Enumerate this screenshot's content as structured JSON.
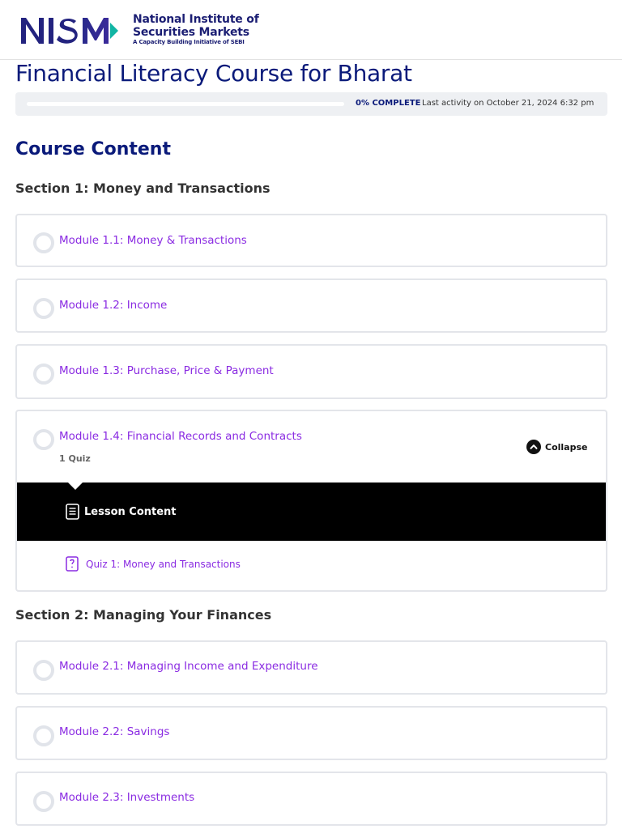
{
  "header": {
    "logo_mark": "NISM",
    "org_name_line1": "National Institute of",
    "org_name_line2": "Securities Markets",
    "tagline": "A Capacity Building Initiative of SEBI"
  },
  "course": {
    "title": "Financial Literacy Course for Bharat",
    "progress_percent": 0,
    "progress_label": "0% COMPLETE",
    "last_activity": "Last activity on October 21, 2024 6:32 pm"
  },
  "content_heading": "Course Content",
  "sections": [
    {
      "title": "Section 1: Money and Transactions",
      "modules": [
        {
          "label": "Module 1.1: Money & Transactions"
        },
        {
          "label": "Module 1.2: Income"
        },
        {
          "label": "Module 1.3: Purchase, Price & Payment"
        },
        {
          "label": "Module 1.4: Financial Records and Contracts",
          "quiz_count": "1 Quiz",
          "collapse_label": "Collapse",
          "lesson_content_label": "Lesson Content",
          "quiz_label": "Quiz 1: Money and Transactions"
        }
      ]
    },
    {
      "title": "Section 2: Managing Your Finances",
      "modules": [
        {
          "label": "Module 2.1: Managing Income and Expenditure"
        },
        {
          "label": "Module 2.2: Savings"
        },
        {
          "label": "Module 2.3: Investments"
        }
      ]
    }
  ],
  "colors": {
    "brand_navy": "#0a1a7a",
    "link_purple": "#8a2be2",
    "card_border": "#e3e5ea",
    "lesson_bar": "#000000"
  }
}
